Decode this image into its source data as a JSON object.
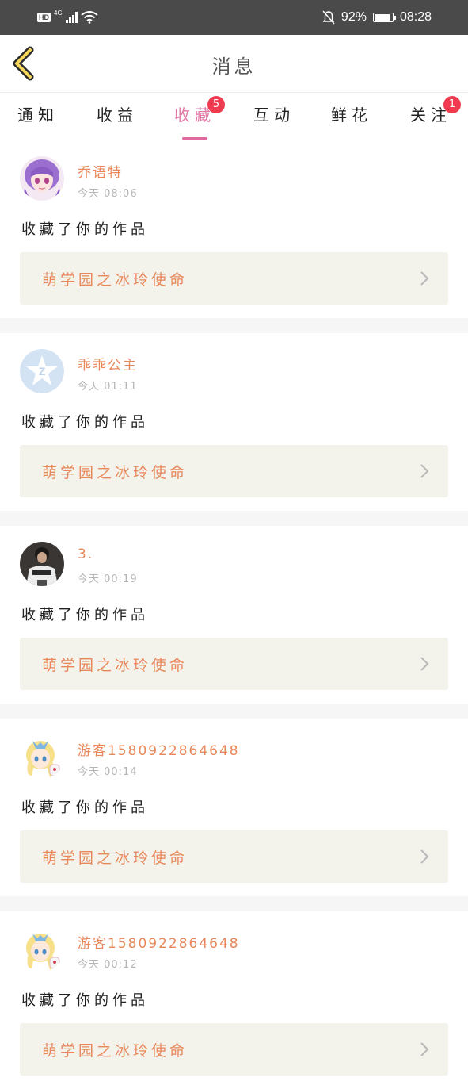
{
  "status_bar": {
    "hd": "HD",
    "network": "4G",
    "battery_text": "92%",
    "battery_level": 0.92,
    "time": "08:28"
  },
  "header": {
    "title": "消息"
  },
  "tabs": [
    {
      "label": "通知",
      "badge": ""
    },
    {
      "label": "收益",
      "badge": ""
    },
    {
      "label": "收藏",
      "badge": "5",
      "active": true
    },
    {
      "label": "互动",
      "badge": ""
    },
    {
      "label": "鲜花",
      "badge": ""
    },
    {
      "label": "关注",
      "badge": "1"
    }
  ],
  "feed": [
    {
      "username": "乔语特",
      "time": "今天 08:06",
      "action": "收藏了你的作品",
      "work_title": "萌学园之冰玲使命",
      "avatar": "anime-girl-purple"
    },
    {
      "username": "乖乖公主",
      "time": "今天 01:11",
      "action": "收藏了你的作品",
      "work_title": "萌学园之冰玲使命",
      "avatar": "default-qq"
    },
    {
      "username": "3.",
      "time": "今天 00:19",
      "action": "收藏了你的作品",
      "work_title": "萌学园之冰玲使命",
      "avatar": "photo-person"
    },
    {
      "username": "游客1580922864648",
      "time": "今天 00:14",
      "action": "收藏了你的作品",
      "work_title": "萌学园之冰玲使命",
      "avatar": "anime-girl-blonde"
    },
    {
      "username": "游客1580922864648",
      "time": "今天 00:12",
      "action": "收藏了你的作品",
      "work_title": "萌学园之冰玲使命",
      "avatar": "anime-girl-blonde"
    }
  ],
  "colors": {
    "accent": "#e27aa7",
    "badge": "#ef3a50",
    "username": "#e8885a",
    "card_bg": "#f3f3ec"
  }
}
